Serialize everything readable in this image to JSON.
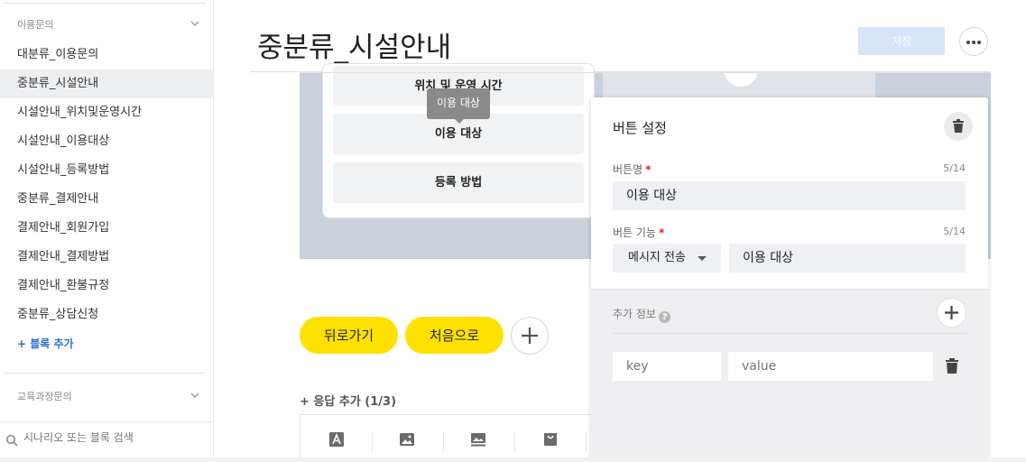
{
  "sidebar": {
    "section1_title": "이용문의",
    "items": [
      {
        "label": "대분류_이용문의"
      },
      {
        "label": "중분류_시설안내"
      },
      {
        "label": "시설안내_위치및운영시간"
      },
      {
        "label": "시설안내_이용대상"
      },
      {
        "label": "시설안내_등록방법"
      },
      {
        "label": "중분류_결제안내"
      },
      {
        "label": "결제안내_회원가입"
      },
      {
        "label": "결제안내_결제방법"
      },
      {
        "label": "결제안내_환불규정"
      },
      {
        "label": "중분류_상담신청"
      }
    ],
    "active_index": 1,
    "add_block": "+ 블록 추가",
    "section2_title": "교육과정문의",
    "search_placeholder": "시나리오 또는 블록 검색"
  },
  "header": {
    "title": "중분류_시설안내",
    "save_label": "저장"
  },
  "preview": {
    "options": [
      "위치 및 운영 시간",
      "이용 대상",
      "등록 방법"
    ],
    "tooltip": "이용 대상"
  },
  "actions": {
    "back": "뒤로가기",
    "home": "처음으로",
    "add_response": "+ 응답 추가 (1/3)"
  },
  "toolbar": {
    "icons": [
      "text-icon",
      "image-icon",
      "wide-image-icon",
      "commerce-icon"
    ]
  },
  "panel": {
    "title": "버튼 설정",
    "name_label": "버튼명",
    "name_count": "5/14",
    "name_value": "이용 대상",
    "function_label": "버튼 기능",
    "function_count": "5/14",
    "function_select": "메시지 전송",
    "function_value": "이용 대상",
    "extra_label": "추가 정보",
    "help": "?",
    "key_placeholder": "key",
    "value_placeholder": "value"
  },
  "colors": {
    "accent_yellow": "#ffe100",
    "save_disabled": "#d7e4f9",
    "required": "#e02020",
    "link_blue": "#2a6fdb"
  }
}
